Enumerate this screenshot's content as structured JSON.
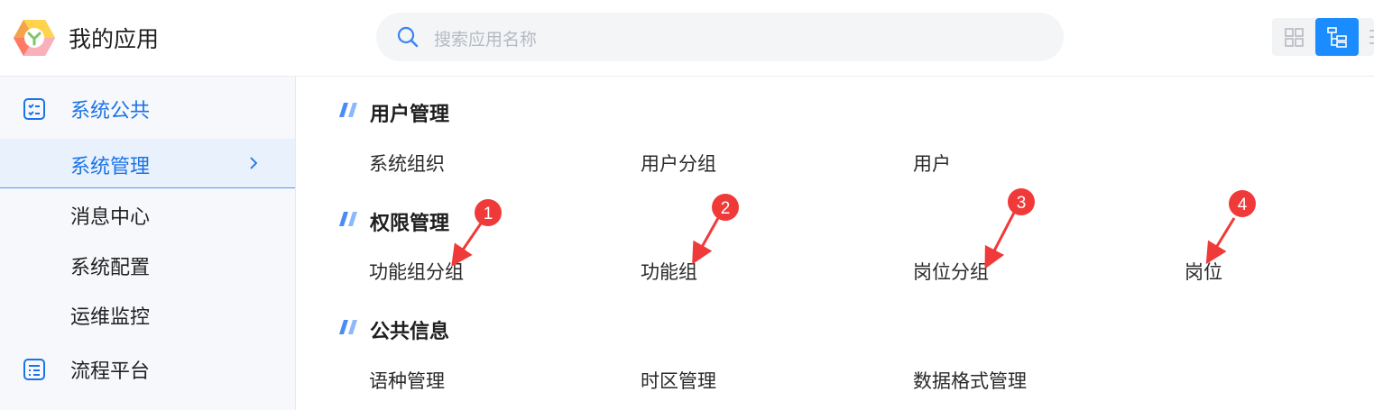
{
  "header": {
    "app_title": "我的应用",
    "search_placeholder": "搜索应用名称",
    "accent": "#1a8cff"
  },
  "sidebar": {
    "groups": [
      {
        "label": "系统公共",
        "icon": "checklist-icon"
      },
      {
        "label": "流程平台",
        "icon": "list-icon"
      }
    ],
    "items": [
      {
        "label": "系统管理",
        "active": true
      },
      {
        "label": "消息中心"
      },
      {
        "label": "系统配置"
      },
      {
        "label": "运维监控"
      }
    ]
  },
  "sections": [
    {
      "title": "用户管理",
      "links": [
        "系统组织",
        "用户分组",
        "用户"
      ]
    },
    {
      "title": "权限管理",
      "links": [
        "功能组分组",
        "功能组",
        "岗位分组",
        "岗位"
      ]
    },
    {
      "title": "公共信息",
      "links": [
        "语种管理",
        "时区管理",
        "数据格式管理"
      ]
    }
  ],
  "annotations": {
    "markers": [
      "1",
      "2",
      "3",
      "4"
    ],
    "color": "#f03a3a"
  }
}
